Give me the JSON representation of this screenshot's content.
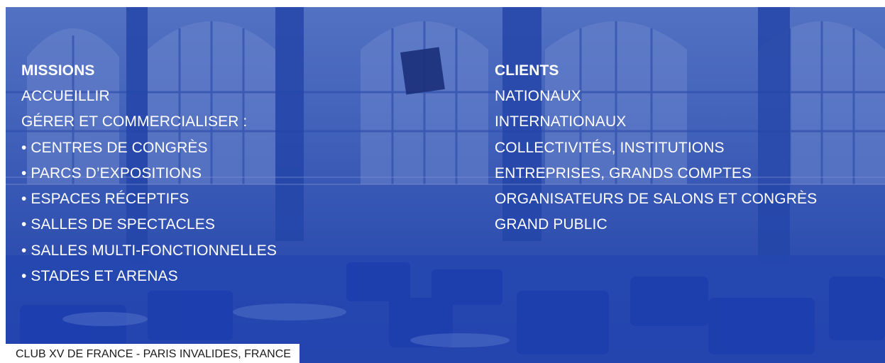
{
  "colors": {
    "overlay": "#2a4ab0",
    "text": "#ffffff",
    "caption_bg": "#ffffff",
    "caption_text": "#1b1b1b"
  },
  "missions": {
    "heading": "MISSIONS",
    "lines": [
      "ACCUEILLIR",
      "GÉRER ET COMMERCIALISER :",
      "• CENTRES DE CONGRÈS",
      "• PARCS D’EXPOSITIONS",
      "• ESPACES RÉCEPTIFS",
      "• SALLES DE SPECTACLES",
      "• SALLES MULTI-FONCTIONNELLES",
      "• STADES ET ARENAS"
    ]
  },
  "clients": {
    "heading": "CLIENTS",
    "lines": [
      "NATIONAUX",
      "INTERNATIONAUX",
      "COLLECTIVITÉS, INSTITUTIONS",
      "ENTREPRISES, GRANDS COMPTES",
      "ORGANISATEURS DE SALONS ET CONGRÈS",
      "GRAND PUBLIC"
    ]
  },
  "caption": "CLUB XV DE FRANCE - PARIS INVALIDES, FRANCE"
}
